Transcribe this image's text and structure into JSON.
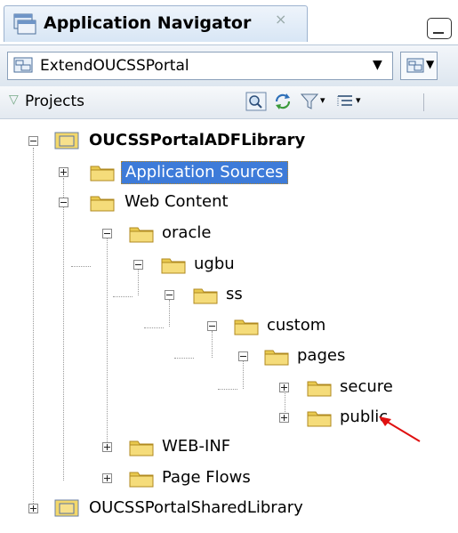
{
  "navigator": {
    "title": "Application Navigator",
    "close_glyph": "×"
  },
  "application": {
    "name": "ExtendOUCSSPortal"
  },
  "projects": {
    "label": "Projects"
  },
  "tree": {
    "root1": {
      "label": "OUCSSPortalADFLibrary"
    },
    "app_sources": {
      "label": "Application Sources"
    },
    "web_content": {
      "label": "Web Content"
    },
    "oracle": {
      "label": "oracle"
    },
    "ugbu": {
      "label": "ugbu"
    },
    "ss": {
      "label": "ss"
    },
    "custom": {
      "label": "custom"
    },
    "pages": {
      "label": "pages"
    },
    "secure": {
      "label": "secure"
    },
    "public": {
      "label": "public"
    },
    "web_inf": {
      "label": "WEB-INF"
    },
    "page_flows": {
      "label": "Page Flows"
    },
    "root2": {
      "label": "OUCSSPortalSharedLibrary"
    }
  },
  "icons": {
    "folder": "folder-icon",
    "project": "project-icon",
    "application": "application-icon"
  },
  "colors": {
    "selection": "#3d7bd9",
    "folder": "#e9c94f",
    "annotation_arrow": "#e01010"
  }
}
